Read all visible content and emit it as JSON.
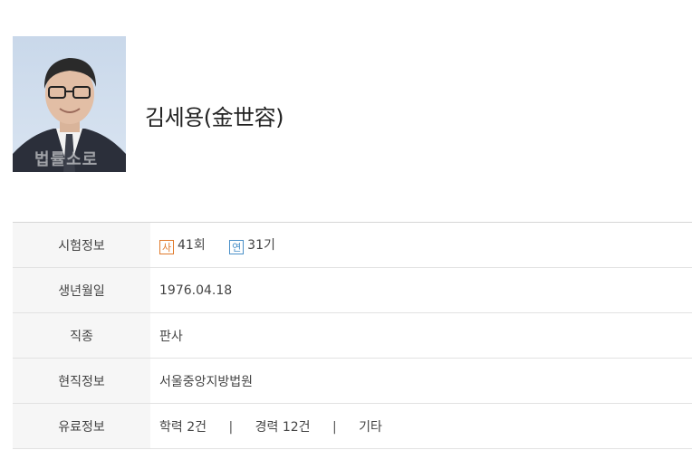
{
  "profile": {
    "name": "김세용(金世容)",
    "photo_watermark": "법률소로"
  },
  "info": {
    "exam": {
      "label": "시험정보",
      "items": [
        {
          "badge": "사",
          "value": "41회",
          "color": "#e07a2c"
        },
        {
          "badge": "연",
          "value": "31기",
          "color": "#4a90c8"
        }
      ]
    },
    "birth": {
      "label": "생년월일",
      "value": "1976.04.18"
    },
    "job": {
      "label": "직종",
      "value": "판사"
    },
    "current": {
      "label": "현직정보",
      "value": "서울중앙지방법원"
    },
    "career": {
      "label": "유료정보",
      "links": [
        "학력 2건",
        "경력 12건",
        "기타"
      ],
      "separator": "|"
    }
  }
}
